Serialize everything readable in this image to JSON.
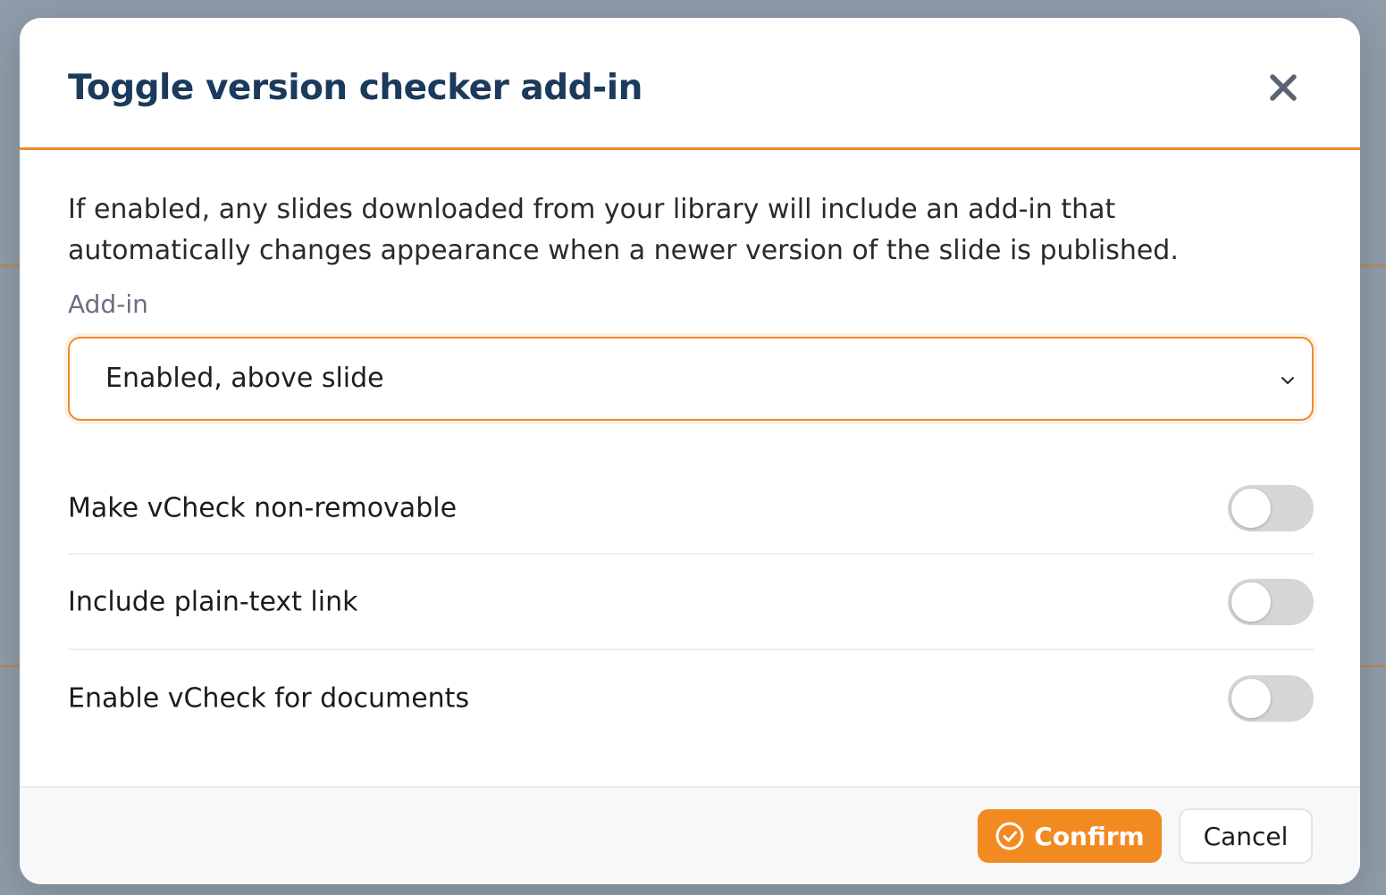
{
  "modal": {
    "title": "Toggle version checker add-in",
    "close_icon": "close-icon",
    "description": "If enabled, any slides downloaded from your library will include an add-in that automatically changes appearance when a newer version of the slide is published.",
    "addin_label": "Add-in",
    "addin_select": {
      "value": "Enabled, above slide",
      "chevron_icon": "chevron-down-icon"
    },
    "toggles": [
      {
        "label": "Make vCheck non-removable",
        "on": false
      },
      {
        "label": "Include plain-text link",
        "on": false
      },
      {
        "label": "Enable vCheck for documents",
        "on": false
      }
    ],
    "footer": {
      "confirm_label": "Confirm",
      "confirm_icon": "check-circle-icon",
      "cancel_label": "Cancel"
    }
  },
  "colors": {
    "accent": "#ef8a2b",
    "title": "#1b3a5c",
    "overlay": "#8d9aa6"
  }
}
